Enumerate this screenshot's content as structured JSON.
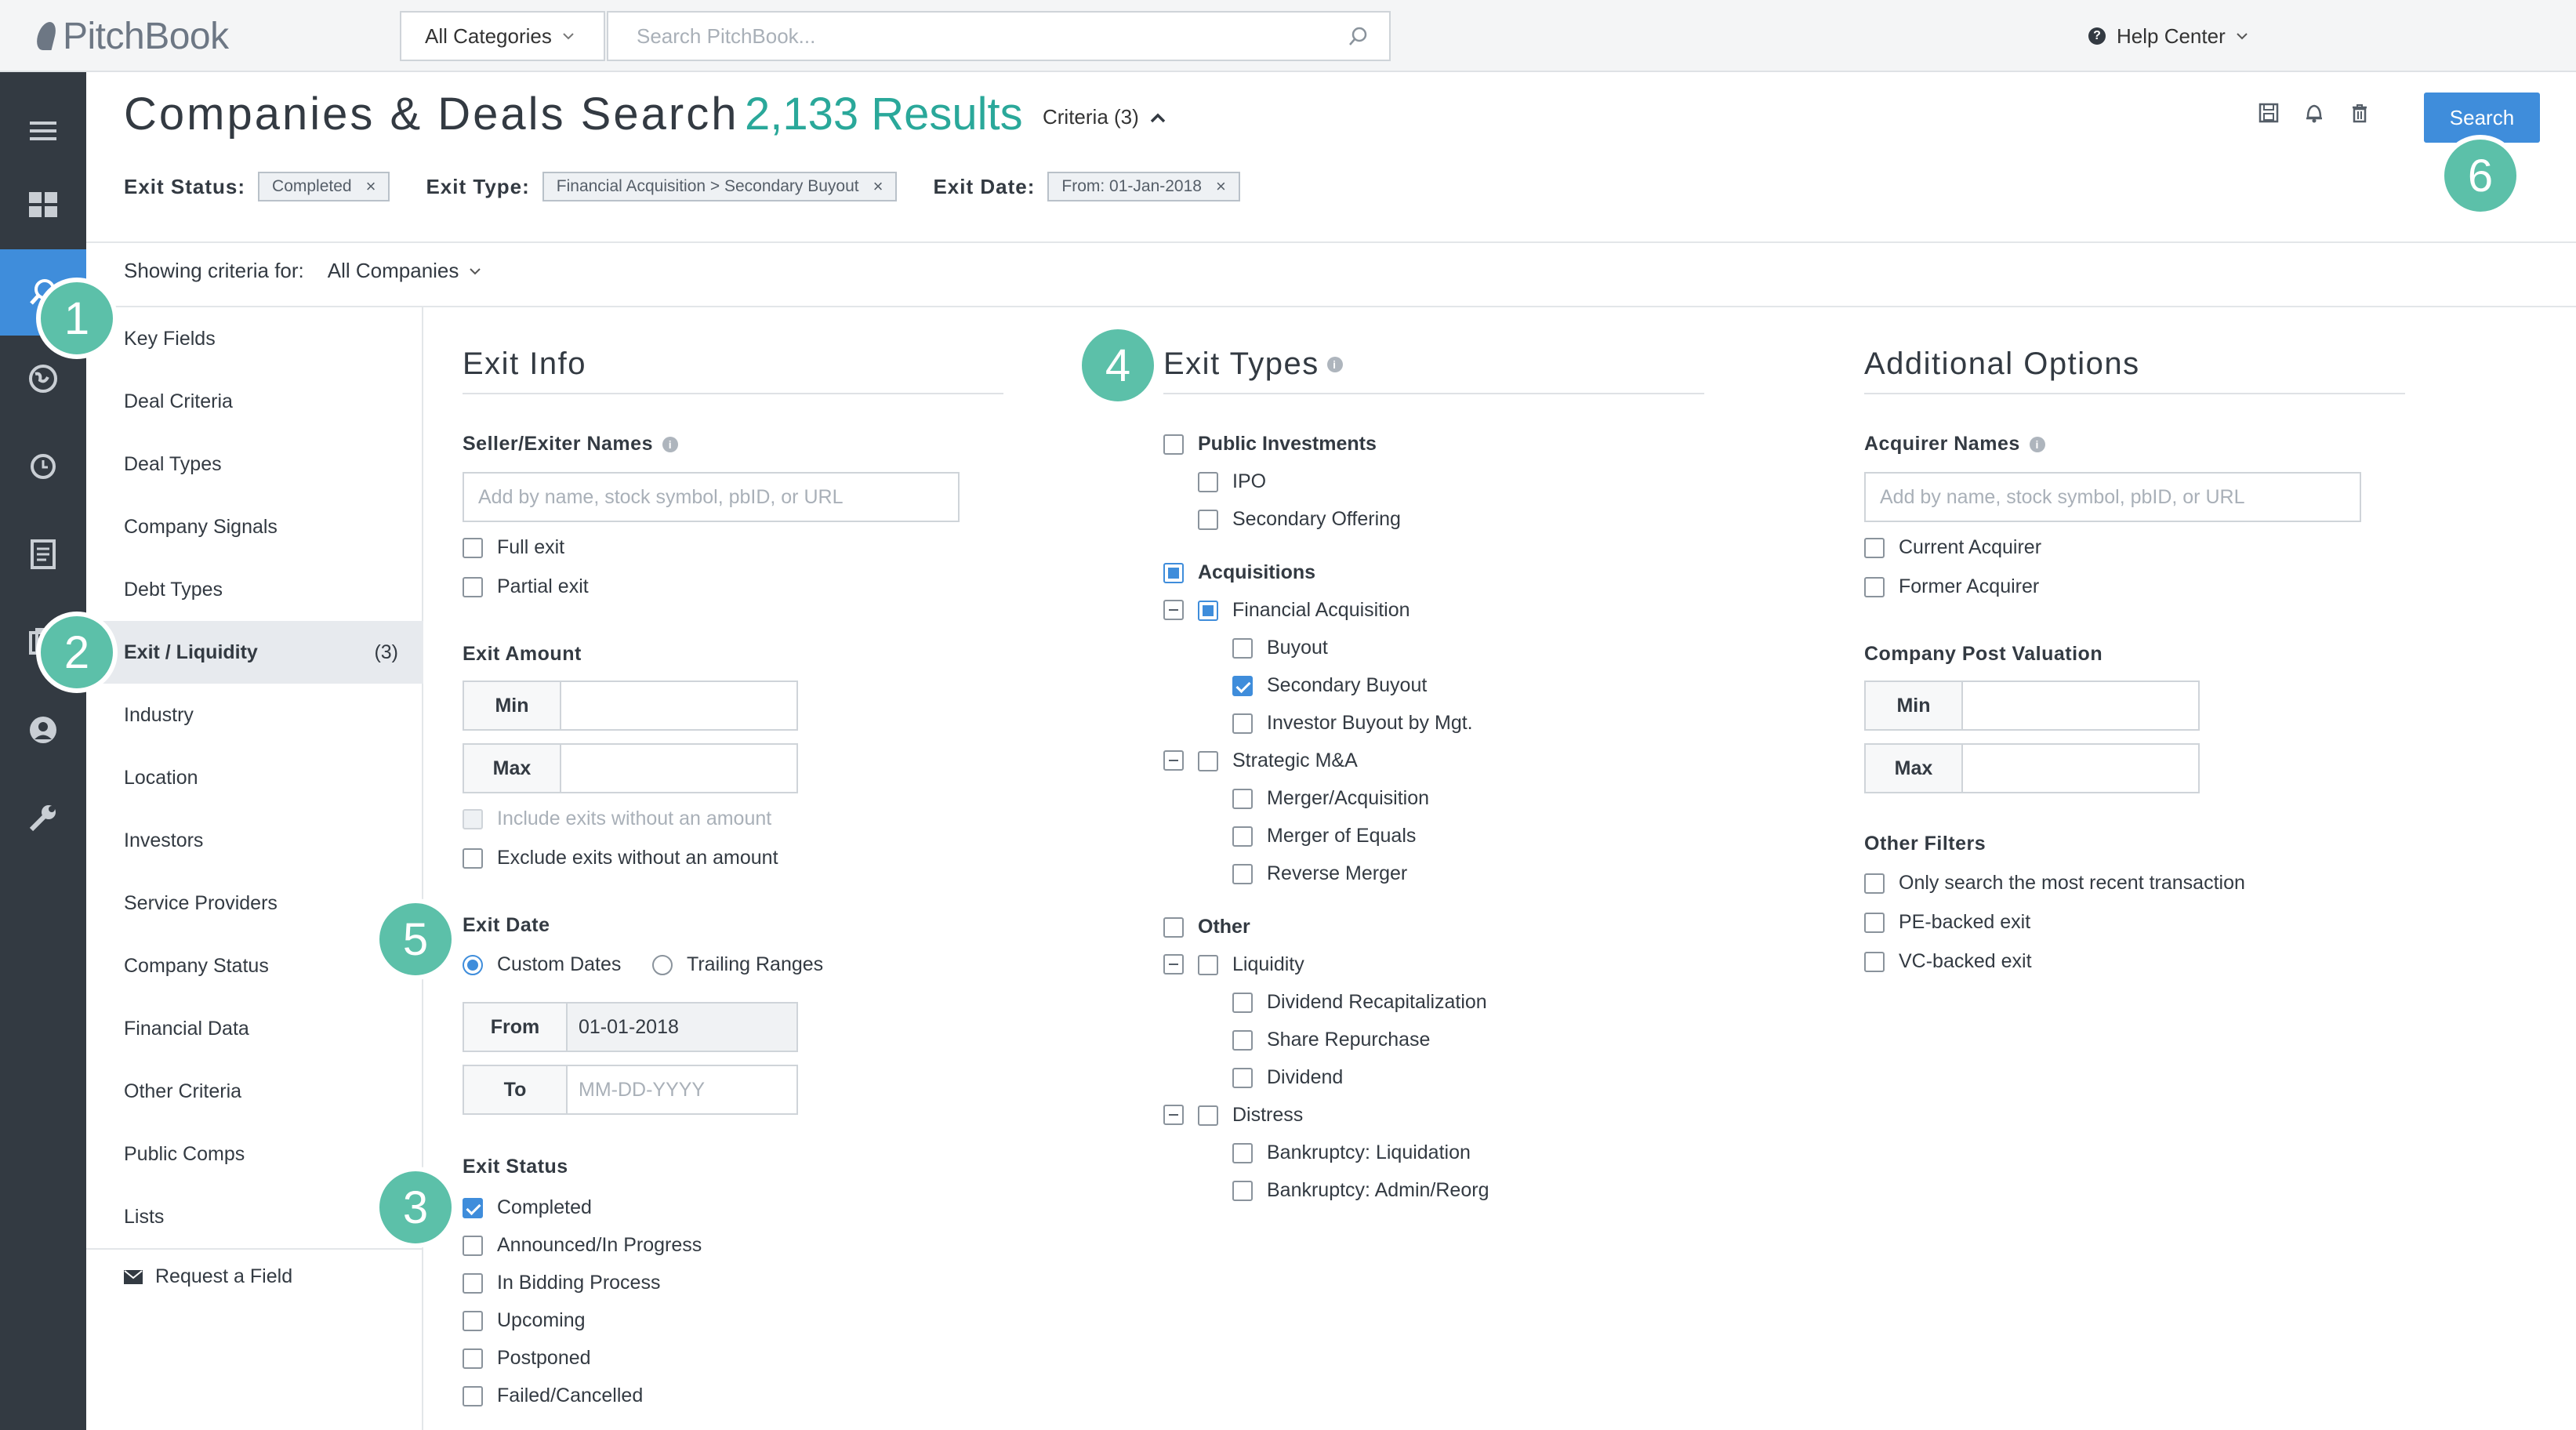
{
  "topbar": {
    "brand": "PitchBook",
    "category": "All Categories",
    "search_placeholder": "Search PitchBook...",
    "help": "Help Center"
  },
  "header": {
    "title": "Companies & Deals Search",
    "results": "2,133 Results",
    "criteria": "Criteria (3)",
    "search_button": "Search"
  },
  "filters": [
    {
      "label": "Exit Status:",
      "chip": "Completed"
    },
    {
      "label": "Exit Type:",
      "chip": "Financial Acquisition > Secondary Buyout"
    },
    {
      "label": "Exit Date:",
      "chip": "From: 01-Jan-2018"
    }
  ],
  "showing": {
    "label": "Showing criteria for:",
    "value": "All Companies"
  },
  "sidebar": {
    "items": [
      {
        "label": "Key Fields",
        "count": ""
      },
      {
        "label": "Deal Criteria",
        "count": ""
      },
      {
        "label": "Deal Types",
        "count": ""
      },
      {
        "label": "Company Signals",
        "count": ""
      },
      {
        "label": "Debt Types",
        "count": ""
      },
      {
        "label": "Exit / Liquidity",
        "count": "(3)"
      },
      {
        "label": "Industry",
        "count": ""
      },
      {
        "label": "Location",
        "count": ""
      },
      {
        "label": "Investors",
        "count": ""
      },
      {
        "label": "Service Providers",
        "count": ""
      },
      {
        "label": "Company Status",
        "count": ""
      },
      {
        "label": "Financial Data",
        "count": ""
      },
      {
        "label": "Other Criteria",
        "count": ""
      },
      {
        "label": "Public Comps",
        "count": ""
      },
      {
        "label": "Lists",
        "count": ""
      }
    ],
    "request": "Request a Field"
  },
  "exit_info": {
    "title": "Exit Info",
    "seller_label": "Seller/Exiter Names",
    "seller_placeholder": "Add by name, stock symbol, pbID, or URL",
    "full_exit": "Full exit",
    "partial_exit": "Partial exit",
    "amount_label": "Exit Amount",
    "min": "Min",
    "max": "Max",
    "include_without": "Include exits without an amount",
    "exclude_without": "Exclude exits without an amount",
    "date_label": "Exit Date",
    "custom_dates": "Custom Dates",
    "trailing_ranges": "Trailing Ranges",
    "from": "From",
    "from_value": "01-01-2018",
    "to": "To",
    "to_placeholder": "MM-DD-YYYY",
    "status_label": "Exit Status",
    "statuses": [
      "Completed",
      "Announced/In Progress",
      "In Bidding Process",
      "Upcoming",
      "Postponed",
      "Failed/Cancelled"
    ]
  },
  "exit_types": {
    "title": "Exit Types",
    "public_investments": "Public Investments",
    "ipo": "IPO",
    "secondary_offering": "Secondary Offering",
    "acquisitions": "Acquisitions",
    "financial_acquisition": "Financial Acquisition",
    "buyout": "Buyout",
    "secondary_buyout": "Secondary Buyout",
    "investor_buyout": "Investor Buyout by Mgt.",
    "strategic": "Strategic M&A",
    "merger_acq": "Merger/Acquisition",
    "merger_equals": "Merger of Equals",
    "reverse_merger": "Reverse Merger",
    "other": "Other",
    "liquidity": "Liquidity",
    "dividend_recap": "Dividend Recapitalization",
    "share_repurchase": "Share Repurchase",
    "dividend": "Dividend",
    "distress": "Distress",
    "bk_liquidation": "Bankruptcy: Liquidation",
    "bk_admin": "Bankruptcy: Admin/Reorg"
  },
  "additional": {
    "title": "Additional Options",
    "acquirer_label": "Acquirer Names",
    "acquirer_placeholder": "Add by name, stock symbol, pbID, or URL",
    "current_acquirer": "Current Acquirer",
    "former_acquirer": "Former Acquirer",
    "valuation_label": "Company Post Valuation",
    "min": "Min",
    "max": "Max",
    "other_filters": "Other Filters",
    "most_recent": "Only search the most recent transaction",
    "pe_backed": "PE-backed exit",
    "vc_backed": "VC-backed exit"
  },
  "callouts": [
    "1",
    "2",
    "3",
    "4",
    "5",
    "6"
  ],
  "colors": {
    "accent": "#3f8ddb",
    "teal": "#2aa89a",
    "callout": "#5cc0a9",
    "rail": "#333a42"
  }
}
